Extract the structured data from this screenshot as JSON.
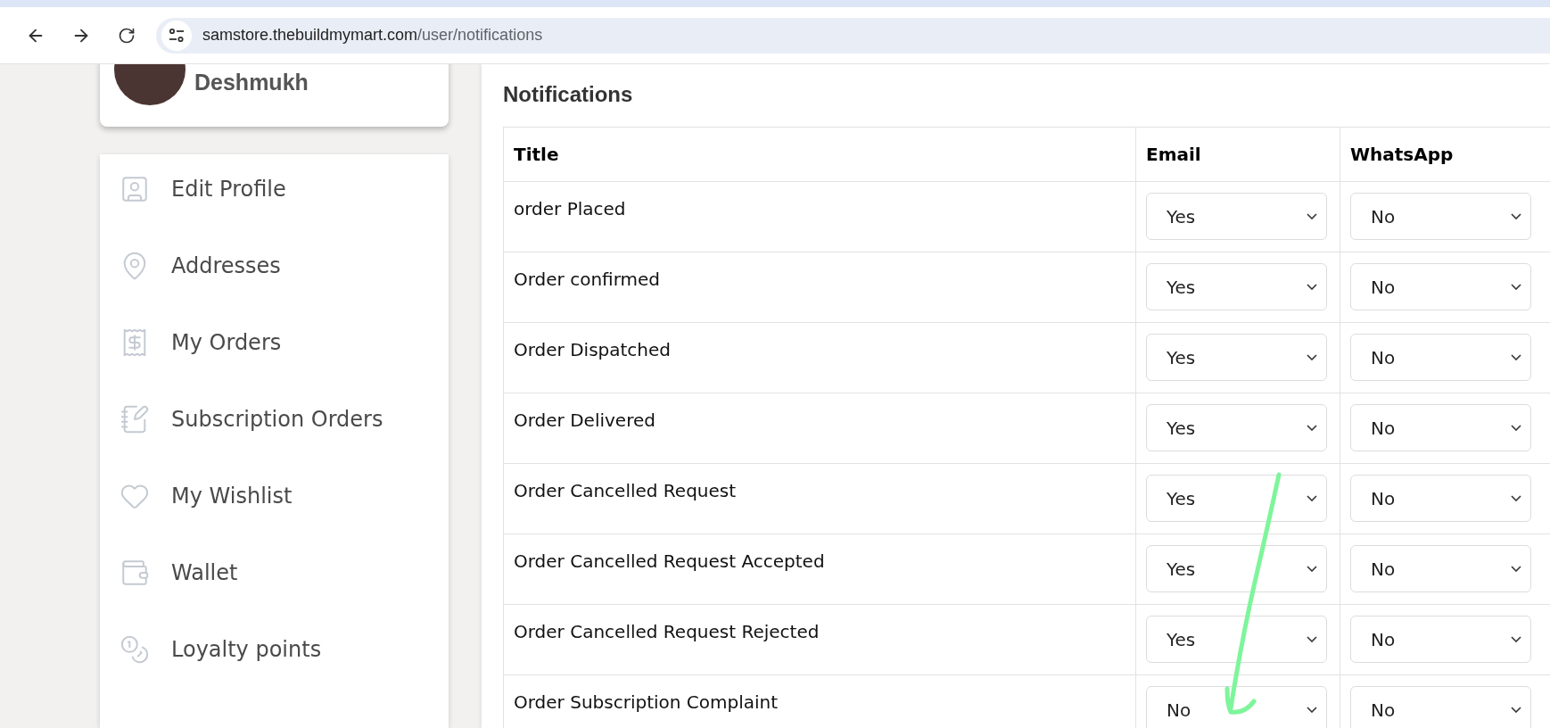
{
  "browser": {
    "url_domain": "samstore.thebuildmymart.com",
    "url_path": "/user/notifications"
  },
  "profile": {
    "name": "Deshmukh"
  },
  "sidebar": {
    "items": [
      {
        "label": "Edit Profile"
      },
      {
        "label": "Addresses"
      },
      {
        "label": "My Orders"
      },
      {
        "label": "Subscription Orders"
      },
      {
        "label": "My Wishlist"
      },
      {
        "label": "Wallet"
      },
      {
        "label": "Loyalty points"
      }
    ]
  },
  "notifications": {
    "title": "Notifications",
    "columns": [
      "Title",
      "Email",
      "WhatsApp"
    ],
    "rows": [
      {
        "title": "order Placed",
        "email": "Yes",
        "whatsapp": "No"
      },
      {
        "title": "Order confirmed",
        "email": "Yes",
        "whatsapp": "No"
      },
      {
        "title": "Order Dispatched",
        "email": "Yes",
        "whatsapp": "No"
      },
      {
        "title": "Order Delivered",
        "email": "Yes",
        "whatsapp": "No"
      },
      {
        "title": "Order Cancelled Request",
        "email": "Yes",
        "whatsapp": "No"
      },
      {
        "title": "Order Cancelled Request Accepted",
        "email": "Yes",
        "whatsapp": "No"
      },
      {
        "title": "Order Cancelled Request Rejected",
        "email": "Yes",
        "whatsapp": "No"
      },
      {
        "title": "Order Subscription Complaint",
        "email": "No",
        "whatsapp": "No"
      }
    ]
  }
}
